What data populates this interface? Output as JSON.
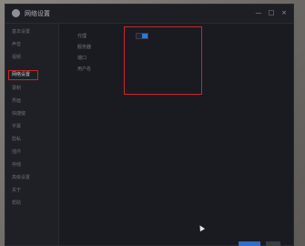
{
  "window": {
    "title": "网络设置",
    "controls": {
      "minimize": "—",
      "maximize": "□",
      "close": "×"
    }
  },
  "sidebar": {
    "items": [
      {
        "label": "基本设置"
      },
      {
        "label": "声音"
      },
      {
        "label": "视频"
      },
      {
        "label": "网络设置"
      },
      {
        "label": "录制"
      },
      {
        "label": "界面"
      },
      {
        "label": "快捷键"
      },
      {
        "label": "字幕"
      },
      {
        "label": "隐私"
      },
      {
        "label": "插件"
      },
      {
        "label": "存储"
      },
      {
        "label": "高级设置"
      },
      {
        "label": "关于"
      },
      {
        "label": "帮助"
      }
    ],
    "active_index": 3
  },
  "content": {
    "rows": [
      {
        "label": "代理"
      },
      {
        "label": "服务器"
      },
      {
        "label": "端口"
      },
      {
        "label": "用户名"
      }
    ],
    "toggle_on": true
  },
  "colors": {
    "accent": "#2e78d8",
    "highlight_outline": "#c7252b",
    "window_bg": "#1b1c22"
  }
}
